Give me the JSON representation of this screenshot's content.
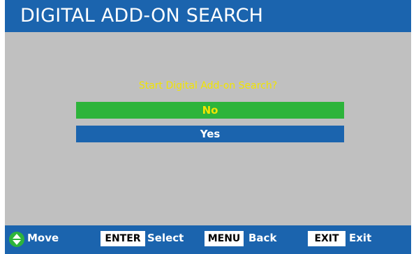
{
  "header": {
    "title": "DIGITAL ADD-ON SEARCH"
  },
  "dialog": {
    "prompt": "Start Digital Add-on Search?",
    "options": [
      {
        "label": "No",
        "selected": true
      },
      {
        "label": "Yes",
        "selected": false
      }
    ]
  },
  "footer": {
    "move_label": "Move",
    "enter_key": "ENTER",
    "enter_label": "Select",
    "menu_key": "MENU",
    "menu_label": "Back",
    "exit_key": "EXIT",
    "exit_label": "Exit",
    "move_icon": "up-down-arrows-icon"
  },
  "colors": {
    "panel_blue": "#1b64ae",
    "body_gray": "#c0c0c0",
    "highlight_green": "#2db43b",
    "prompt_yellow": "#f2e400"
  }
}
